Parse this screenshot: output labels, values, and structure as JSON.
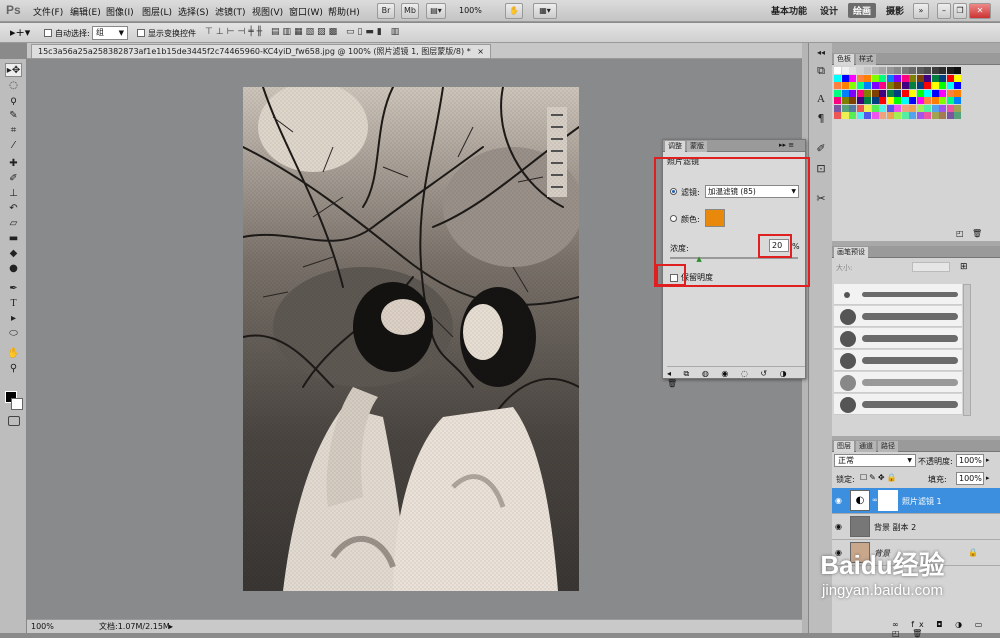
{
  "menubar": {
    "logo": "Ps",
    "items": [
      "文件(F)",
      "编辑(E)",
      "图像(I)",
      "图层(L)",
      "选择(S)",
      "滤镜(T)",
      "视图(V)",
      "窗口(W)",
      "帮助(H)"
    ],
    "br_label": "Br",
    "mb_label": "Mb",
    "zoom": "100%",
    "workspaces": [
      "基本功能",
      "设计",
      "绘画",
      "摄影"
    ],
    "active_workspace": "绘画"
  },
  "options": {
    "auto_select_label": "自动选择:",
    "auto_select_value": "组",
    "show_transform_label": "显示变换控件"
  },
  "document": {
    "tab_title": "15c3a56a25a258382873af1e1b15de3445f2c74465960-KC4yiD_fw658.jpg @ 100% (照片滤镜 1, 图层蒙版/8) *",
    "close": "×"
  },
  "status": {
    "zoom": "100%",
    "doc_info": "文档:1.07M/2.15M"
  },
  "swatches": {
    "tabs": [
      "色板",
      "样式"
    ],
    "row_colors": [
      "#ff0000",
      "#ffff00",
      "#00ff00",
      "#00ffff",
      "#0000ff",
      "#ff00ff",
      "#ff8040",
      "#ff8000",
      "#80ff00",
      "#00ff80",
      "#0080ff",
      "#8000ff",
      "#ff0080",
      "#808000",
      "#804000",
      "#400080",
      "#008040",
      "#004080"
    ]
  },
  "adjustments": {
    "tabs": [
      "调整",
      "蒙版"
    ],
    "title": "照片滤镜",
    "filter_label": "滤镜:",
    "filter_value": "加温滤镜 (85)",
    "color_label": "颜色:",
    "color_value": "#e8890c",
    "density_label": "浓度:",
    "density_value": "20",
    "density_unit": "%",
    "preserve_label": "保留明度",
    "density_fraction": 0.2
  },
  "brushes": {
    "tabs": [
      "画笔预设"
    ],
    "size_label": "大小:"
  },
  "layers": {
    "tabs": [
      "图层",
      "通道",
      "路径"
    ],
    "blend_mode": "正常",
    "opacity_label": "不透明度:",
    "opacity_value": "100%",
    "lock_label": "锁定:",
    "fill_label": "填充:",
    "fill_value": "100%",
    "items": [
      {
        "name": "照片滤镜 1",
        "selected": true
      },
      {
        "name": "背景 副本 2",
        "selected": false
      },
      {
        "name": "背景",
        "selected": false
      }
    ]
  },
  "watermark": {
    "brand": "Baidu经验",
    "url": "jingyan.baidu.com"
  }
}
